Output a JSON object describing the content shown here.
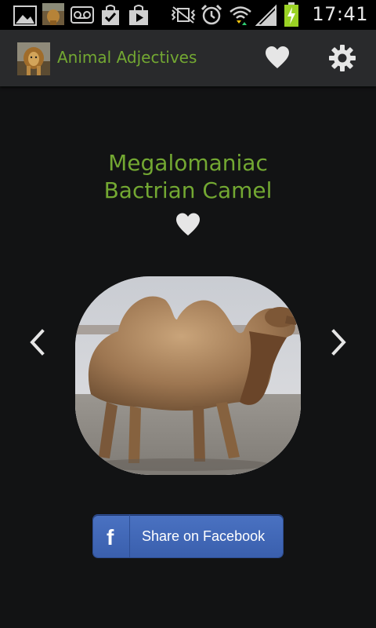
{
  "status_bar": {
    "time": "17:41",
    "left_icons": [
      "gallery-icon",
      "app-thumbnail-icon",
      "voicemail-icon",
      "task-done-icon",
      "play-store-icon"
    ],
    "right_icons": [
      "vibrate-mute-icon",
      "alarm-icon",
      "wifi-icon",
      "signal-icon",
      "battery-charging-icon"
    ]
  },
  "action_bar": {
    "title": "Animal Adjectives",
    "icons": [
      "heart-icon",
      "gear-icon"
    ]
  },
  "animal": {
    "adjective": "Megalomaniac",
    "name": "Bactrian Camel"
  },
  "share": {
    "label": "Share on Facebook",
    "logo_letter": "f"
  },
  "colors": {
    "accent_green": "#73a832",
    "background": "#121314",
    "action_bar": "#292a2c",
    "facebook_blue": "#3b5fad"
  }
}
